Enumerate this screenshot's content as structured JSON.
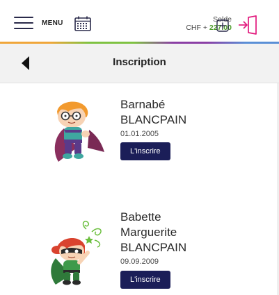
{
  "header": {
    "menu_label": "MENU",
    "solde_label": "Solde",
    "currency": "CHF + ",
    "amount": "227.00",
    "icons": [
      "hamburger-icon",
      "calendar-icon",
      "plus-square-icon",
      "logout-icon"
    ],
    "colors": {
      "amount": "#4f9d2d",
      "logout": "#e2197d",
      "rainbow": [
        "#f0a63a",
        "#7fc242",
        "#8b3fa5",
        "#5a8fd6"
      ]
    }
  },
  "titlebar": {
    "title": "Inscription"
  },
  "children": [
    {
      "first_name": "Barnabé",
      "last_name": "BLANCPAIN",
      "birthdate": "01.01.2005",
      "button_label": "L'inscrire"
    },
    {
      "first_name": "Babette",
      "middle_name": "Marguerite",
      "last_name": "BLANCPAIN",
      "birthdate": "09.09.2009",
      "button_label": "L'inscrire"
    }
  ],
  "colors": {
    "button": "#1b1e58"
  }
}
